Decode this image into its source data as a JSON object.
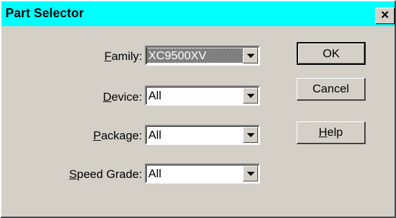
{
  "window": {
    "title": "Part Selector",
    "close_glyph": "×",
    "titlebar_color": "#00ffff",
    "face_color": "#d4d0c8"
  },
  "fields": {
    "family": {
      "label_accel": "F",
      "label_rest": "amily:",
      "value": "XC9500XV"
    },
    "device": {
      "label_accel": "D",
      "label_rest": "evice:",
      "value": "All"
    },
    "package": {
      "label_accel": "P",
      "label_rest": "ackage:",
      "value": "All"
    },
    "speed": {
      "label_accel": "S",
      "label_rest": "peed Grade:",
      "value": "All"
    }
  },
  "buttons": {
    "ok": {
      "label": "OK"
    },
    "cancel": {
      "label": "Cancel"
    },
    "help": {
      "label_accel": "H",
      "label_rest": "elp"
    }
  },
  "icons": {
    "dropdown": "chevron-down-icon",
    "close": "close-icon"
  }
}
